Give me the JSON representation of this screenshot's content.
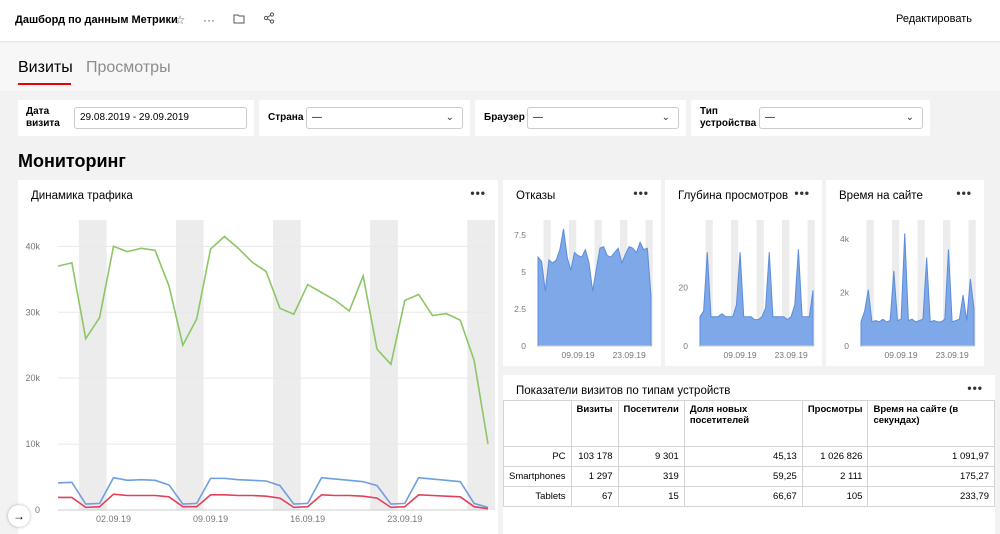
{
  "header": {
    "title": "Дашборд по данным Метрики",
    "edit_label": "Редактировать"
  },
  "tabs": [
    {
      "label": "Визиты",
      "active": true
    },
    {
      "label": "Просмотры",
      "active": false
    }
  ],
  "filters": {
    "date": {
      "label": "Дата визита",
      "value": "29.08.2019 - 29.09.2019"
    },
    "country": {
      "label": "Страна",
      "value": "—"
    },
    "browser": {
      "label": "Браузер",
      "value": "—"
    },
    "device": {
      "label": "Тип устройства",
      "value": "—"
    }
  },
  "section_title": "Мониторинг",
  "traffic": {
    "title": "Динамика трафика",
    "chart_data": {
      "type": "line",
      "x": [
        "29.08",
        "30.08",
        "31.08",
        "01.09",
        "02.09",
        "03.09",
        "04.09",
        "05.09",
        "06.09",
        "07.09",
        "08.09",
        "09.09",
        "10.09",
        "11.09",
        "12.09",
        "13.09",
        "14.09",
        "15.09",
        "16.09",
        "17.09",
        "18.09",
        "19.09",
        "20.09",
        "21.09",
        "22.09",
        "23.09",
        "24.09",
        "25.09",
        "26.09",
        "27.09",
        "28.09",
        "29.09"
      ],
      "xticks": [
        "02.09.19",
        "09.09.19",
        "16.09.19",
        "23.09.19"
      ],
      "yticks": [
        "0",
        "10k",
        "20k",
        "30k",
        "40k"
      ],
      "ylim": [
        0,
        44000
      ],
      "colors": [
        "#8cc665",
        "#6e9fe0",
        "#e0405a"
      ],
      "series": [
        {
          "values": [
            37000,
            37500,
            26000,
            29200,
            40000,
            39200,
            39700,
            39400,
            34000,
            25000,
            29000,
            39600,
            41500,
            39700,
            37600,
            36200,
            30600,
            29700,
            34200,
            33000,
            31800,
            30200,
            35500,
            24400,
            22100,
            31800,
            32700,
            29500,
            29800,
            28800,
            22700,
            10000
          ]
        },
        {
          "values": [
            4100,
            4200,
            900,
            1000,
            4900,
            4500,
            4600,
            4500,
            3800,
            900,
            1000,
            4800,
            4800,
            4600,
            4500,
            4400,
            3700,
            900,
            1000,
            4900,
            4700,
            4500,
            4300,
            3700,
            900,
            1000,
            4900,
            4700,
            4500,
            4300,
            1000,
            400
          ]
        },
        {
          "values": [
            1900,
            1900,
            400,
            500,
            2400,
            2200,
            2200,
            2200,
            2000,
            500,
            500,
            2300,
            2300,
            2200,
            2200,
            2100,
            1800,
            400,
            500,
            2300,
            2200,
            2200,
            2100,
            1800,
            400,
            500,
            2300,
            2200,
            2100,
            2000,
            500,
            200
          ]
        }
      ]
    }
  },
  "mini": [
    {
      "title": "Отказы",
      "chart_data": {
        "type": "area",
        "yticks": [
          "0",
          "2.5",
          "5",
          "7.5"
        ],
        "ylim": [
          0,
          8.5
        ],
        "xticks": [
          "09.09.19",
          "23.09.19"
        ],
        "values": [
          6.0,
          5.7,
          3.7,
          5.8,
          5.6,
          5.8,
          6.5,
          7.9,
          6.0,
          5.1,
          6.3,
          6.1,
          6.0,
          6.5,
          5.6,
          3.7,
          5.2,
          6.6,
          6.7,
          6.1,
          6.0,
          6.3,
          6.6,
          5.6,
          6.2,
          6.7,
          6.6,
          6.3,
          7.0,
          6.5,
          6.6,
          3.4
        ]
      }
    },
    {
      "title": "Глубина просмотров",
      "chart_data": {
        "type": "area",
        "yticks": [
          "0",
          "20"
        ],
        "ylim": [
          0,
          43
        ],
        "xticks": [
          "09.09.19",
          "23.09.19"
        ],
        "values": [
          10,
          12,
          32,
          10,
          10,
          10,
          11,
          10,
          10,
          10,
          14,
          32,
          10,
          10,
          10,
          9,
          9,
          10,
          13,
          32,
          10,
          10,
          10,
          10,
          9,
          10,
          14,
          33,
          10,
          10,
          10,
          19
        ]
      }
    },
    {
      "title": "Время на сайте",
      "chart_data": {
        "type": "area",
        "yticks": [
          "0",
          "2k",
          "4k"
        ],
        "ylim": [
          0,
          4700
        ],
        "xticks": [
          "09.09.19",
          "23.09.19"
        ],
        "values": [
          900,
          1300,
          2100,
          900,
          950,
          900,
          1000,
          900,
          950,
          2800,
          950,
          1000,
          4200,
          950,
          1000,
          900,
          950,
          1000,
          3300,
          900,
          950,
          900,
          900,
          1000,
          3600,
          900,
          950,
          1000,
          1900,
          950,
          2500,
          1400
        ]
      }
    }
  ],
  "devices": {
    "title": "Показатели визитов по типам устройств",
    "columns": [
      "",
      "Визиты",
      "Посетители",
      "Доля новых посетителей",
      "Просмотры",
      "Время на сайте (в секундах)"
    ],
    "rows": [
      [
        "PC",
        "103 178",
        "9 301",
        "45,13",
        "1 026 826",
        "1 091,97"
      ],
      [
        "Smartphones",
        "1 297",
        "319",
        "59,25",
        "2 111",
        "175,27"
      ],
      [
        "Tablets",
        "67",
        "15",
        "66,67",
        "105",
        "233,79"
      ]
    ]
  }
}
